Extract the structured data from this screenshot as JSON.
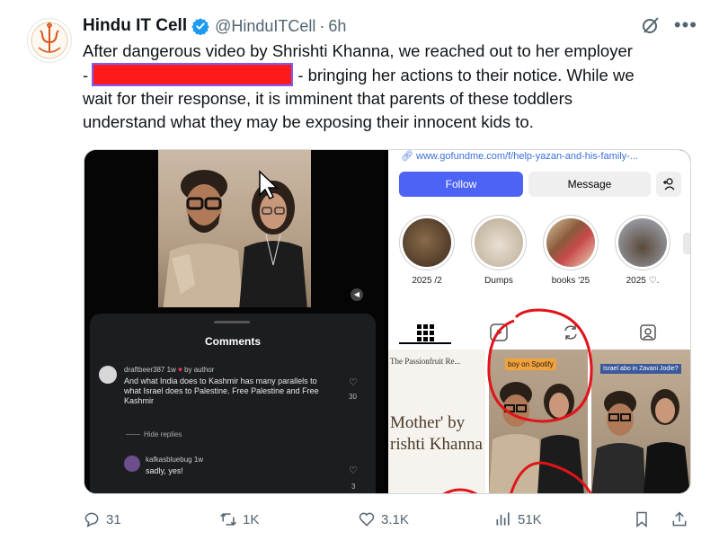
{
  "tweet": {
    "author_name": "Hindu IT Cell",
    "handle": "@HinduITCell",
    "separator": "·",
    "time": "6h",
    "text_line1": "After dangerous video by Shrishti Khanna, we reached out to her employer",
    "text_line2_prefix": "-",
    "text_line2_suffix": "- bringing her actions to their notice. While we",
    "text_line3": "wait for their response, it is imminent that parents of these toddlers",
    "text_line4": "understand what they may be exposing their innocent kids to."
  },
  "media": {
    "left": {
      "comments_title": "Comments",
      "comment1_user": "draftbeer387",
      "comment1_meta": "1w",
      "comment1_author_tag": "by author",
      "comment1_text": "And what India does to Kashmir has many parallels to what Israel does to Palestine. Free Palestine and Free Kashmir",
      "comment1_likes": "30",
      "hide_replies": "Hide replies",
      "comment2_user": "kafkasbluebug",
      "comment2_meta": "1w",
      "comment2_text": "sadly, yes!",
      "comment2_likes": "3"
    },
    "right": {
      "url": "www.gofundme.com/f/help-yazan-and-his-family-...",
      "follow_label": "Follow",
      "message_label": "Message",
      "highlights": [
        "2025 /2",
        "Dumps",
        "books '25",
        "2025 ♡."
      ],
      "grid_cell1_top": "The Passionfruit Re...",
      "grid_cell1_main_line1": "Mother' by",
      "grid_cell1_main_line2": "rishti Khanna",
      "grid_cell2_tag": "boy on Spotify",
      "grid_cell3_tag": "Israel abo in Zavani Jodie?"
    }
  },
  "actions": {
    "replies": "31",
    "reposts": "1K",
    "likes": "3.1K",
    "views": "51K"
  },
  "colors": {
    "accent": "#1d9bf0",
    "redaction": "#ff1a1a",
    "annotation_red": "#e0141a"
  }
}
